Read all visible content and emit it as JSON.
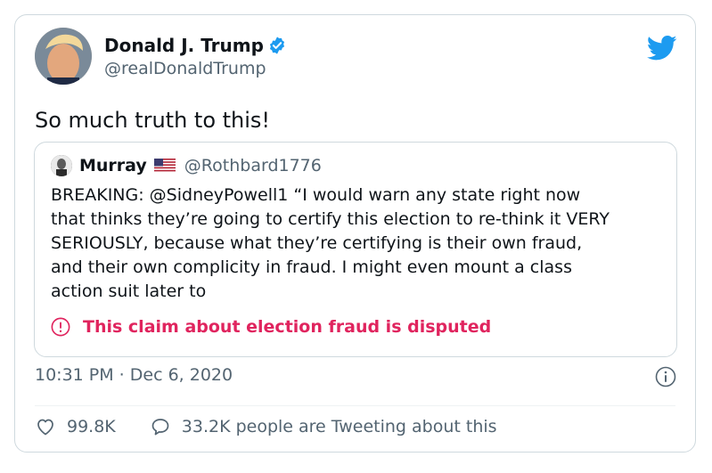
{
  "author": {
    "name": "Donald J. Trump",
    "handle": "@realDonaldTrump"
  },
  "tweet": {
    "text": "So much truth to this!"
  },
  "quoted": {
    "name": "Murray",
    "handle": "@Rothbard1776",
    "body": "BREAKING: @SidneyPowell1 “I would warn any state right now\nthat thinks they’re going to certify this election to re-think it VERY\nSERIOUSLY, because what they’re certifying is their own fraud,\nand their own complicity in fraud. I might even mount a class\naction suit later to",
    "warning": "This claim about election fraud is disputed"
  },
  "meta": {
    "timestamp": "10:31 PM · Dec 6, 2020"
  },
  "actions": {
    "likes": "99.8K",
    "tweeting": "33.2K people are Tweeting about this"
  },
  "colors": {
    "accent": "#1d9bf0",
    "warning": "#e0245e",
    "secondary_text": "#536471"
  },
  "icons": [
    "verified-badge-icon",
    "twitter-bird-icon",
    "us-flag-icon",
    "warning-icon",
    "info-icon",
    "heart-icon",
    "speech-bubble-icon"
  ]
}
